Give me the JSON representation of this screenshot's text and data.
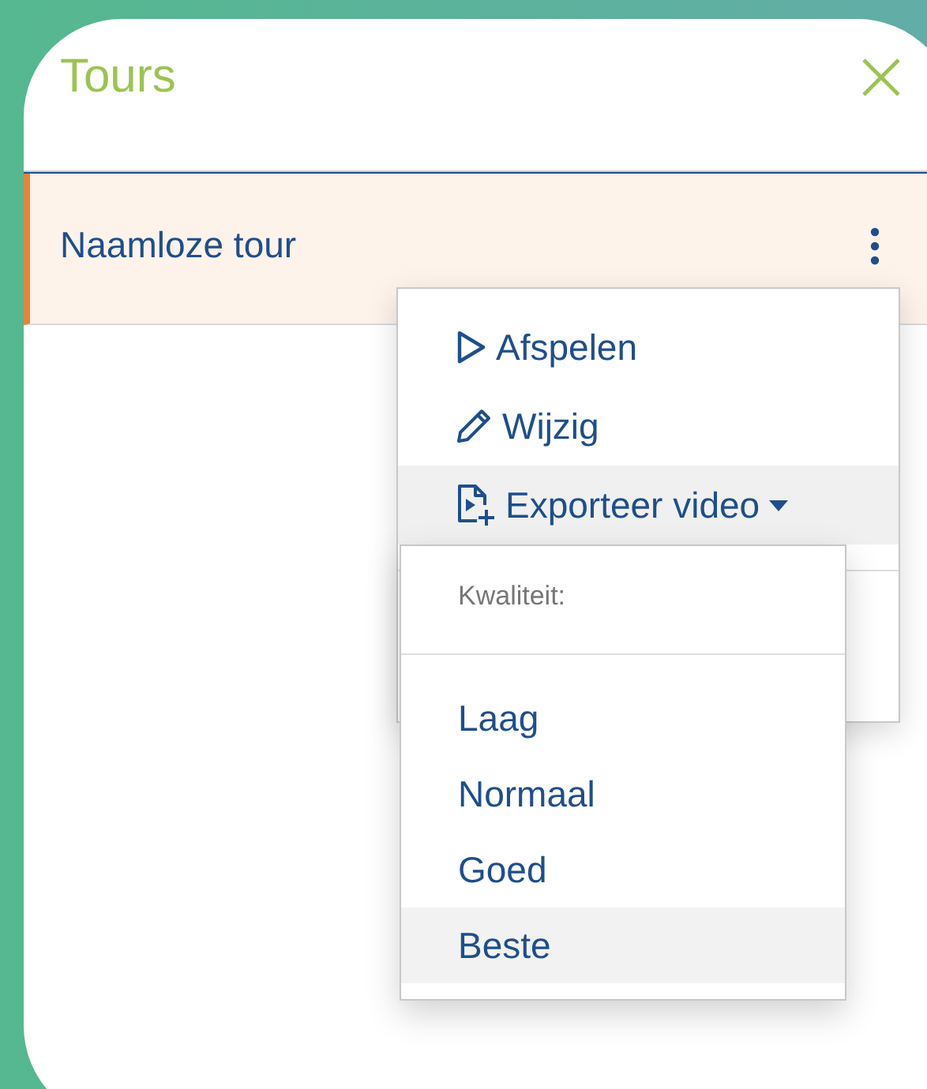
{
  "panel": {
    "title": "Tours"
  },
  "tours": [
    {
      "name": "Naamloze tour",
      "selected": true
    }
  ],
  "menu": [
    {
      "label": "Afspelen",
      "kind": "play",
      "highlighted": false
    },
    {
      "label": "Wijzig",
      "kind": "edit",
      "highlighted": false
    },
    {
      "label": "Exporteer video",
      "kind": "export",
      "highlighted": true
    }
  ],
  "submenu": {
    "header": "Kwaliteit:",
    "options": [
      {
        "label": "Laag",
        "highlighted": false
      },
      {
        "label": "Normaal",
        "highlighted": false
      },
      {
        "label": "Goed",
        "highlighted": false
      },
      {
        "label": "Beste",
        "highlighted": true
      }
    ]
  }
}
